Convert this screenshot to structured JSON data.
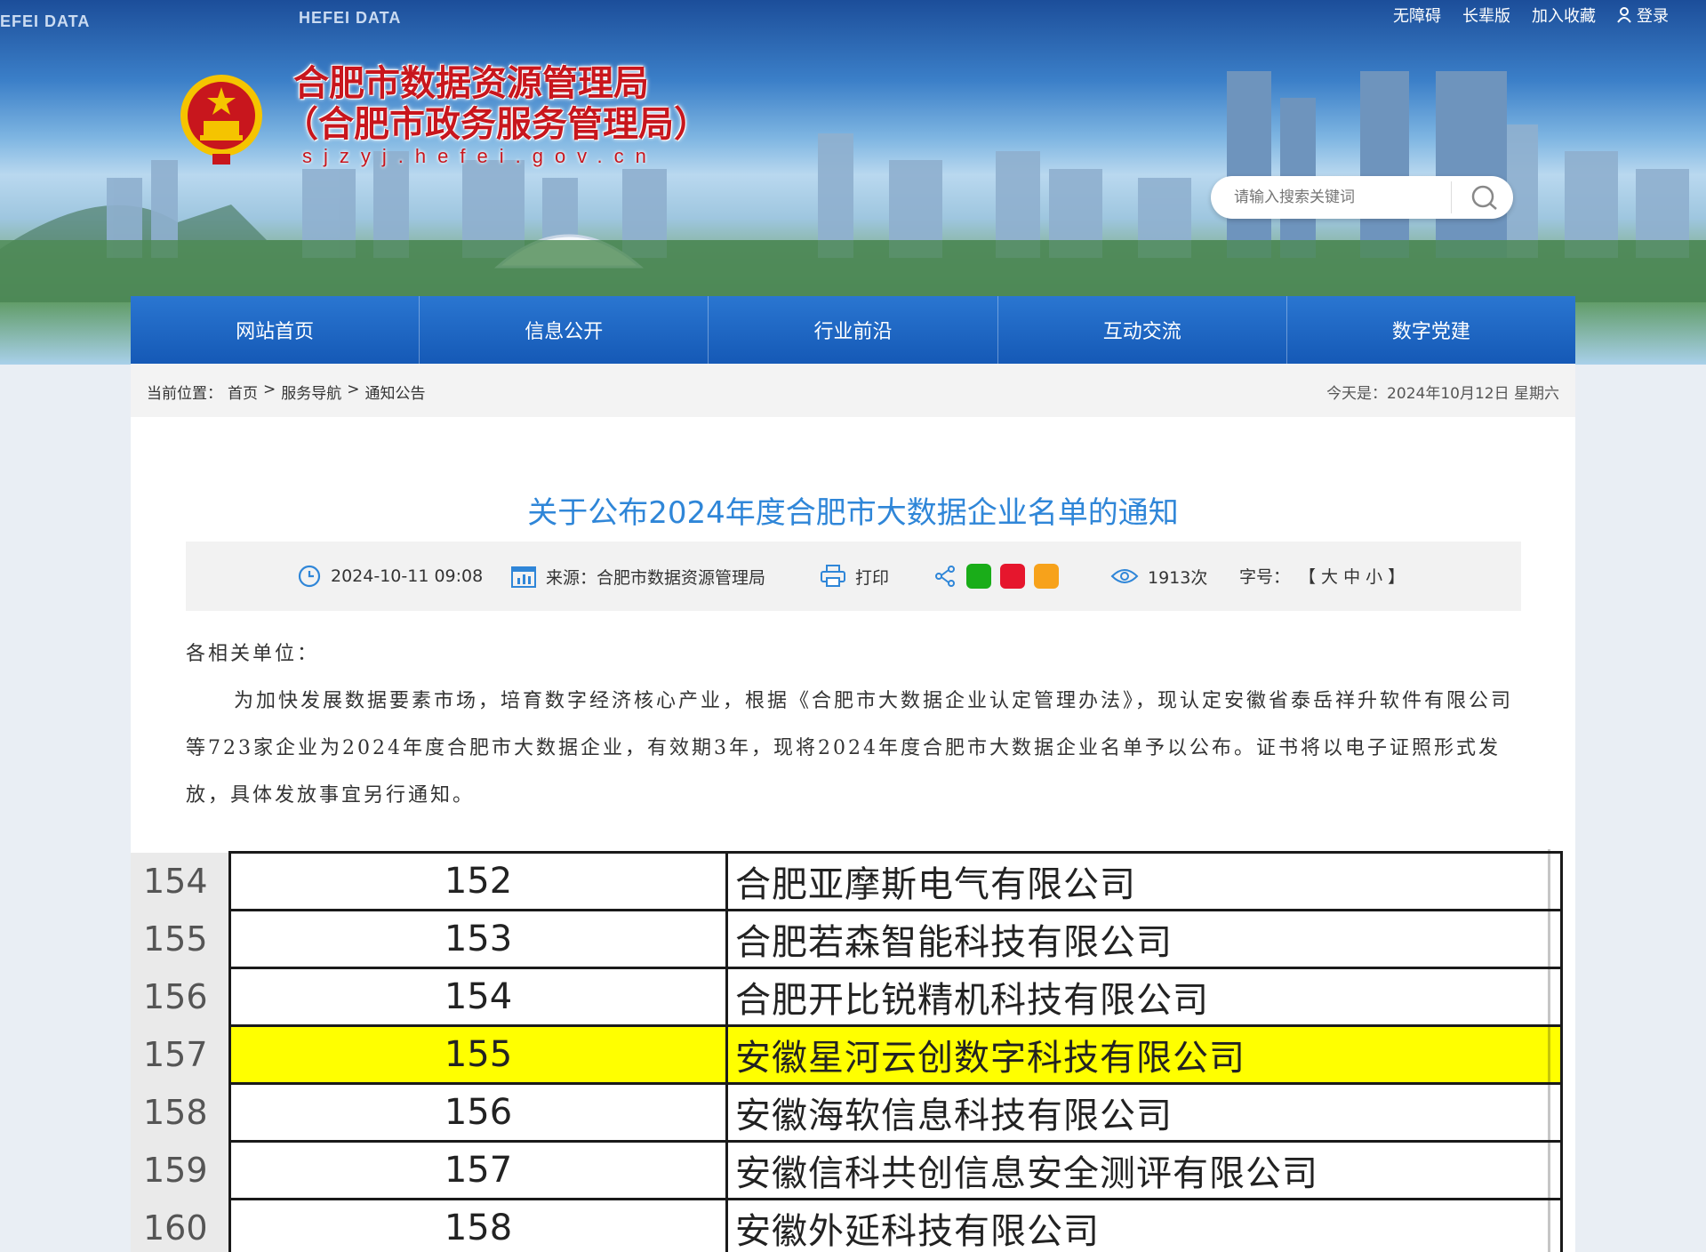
{
  "header": {
    "data_tags": [
      "EFEI DATA",
      "HEFEI DATA"
    ],
    "top_links": [
      "无障碍",
      "长辈版",
      "加入收藏",
      "登录"
    ],
    "site_name": "合肥市数据资源管理局",
    "site_sub": "（合肥市政务服务管理局）",
    "site_domain": "sjzyj.hefei.gov.cn",
    "search_placeholder": "请输入搜索关键词"
  },
  "nav": [
    "网站首页",
    "信息公开",
    "行业前沿",
    "互动交流",
    "数字党建"
  ],
  "breadcrumb": {
    "label": "当前位置：",
    "items": [
      "首页",
      "服务导航",
      "通知公告"
    ],
    "sep": ">",
    "today": "今天是：2024年10月12日 星期六"
  },
  "article": {
    "title": "关于公布2024年度合肥市大数据企业名单的通知",
    "date": "2024-10-11 09:08",
    "source": "来源：合肥市数据资源管理局",
    "print": "打印",
    "views": "1913次",
    "font_size_label": "字号：",
    "font_size_options": "【 大 中 小 】",
    "salutation": "各相关单位：",
    "paragraph": "为加快发展数据要素市场，培育数字经济核心产业，根据《合肥市大数据企业认定管理办法》，现认定安徽省泰岳祥升软件有限公司等723家企业为2024年度合肥市大数据企业，有效期3年，现将2024年度合肥市大数据企业名单予以公布。证书将以电子证照形式发放，具体发放事宜另行通知。"
  },
  "sheet_rows": [
    {
      "row": "154",
      "no": "152",
      "name": "合肥亚摩斯电气有限公司",
      "highlight": false
    },
    {
      "row": "155",
      "no": "153",
      "name": "合肥若森智能科技有限公司",
      "highlight": false
    },
    {
      "row": "156",
      "no": "154",
      "name": "合肥开比锐精机科技有限公司",
      "highlight": false
    },
    {
      "row": "157",
      "no": "155",
      "name": "安徽星河云创数字科技有限公司",
      "highlight": true
    },
    {
      "row": "158",
      "no": "156",
      "name": "安徽海软信息科技有限公司",
      "highlight": false
    },
    {
      "row": "159",
      "no": "157",
      "name": "安徽信科共创信息安全测评有限公司",
      "highlight": false
    },
    {
      "row": "160",
      "no": "158",
      "name": "安徽外延科技有限公司",
      "highlight": false
    }
  ],
  "colors": {
    "nav_blue": "#1f6cc6",
    "title_blue": "#2f86d8",
    "emblem_red": "#c8161d",
    "highlight_yellow": "#ffff00"
  }
}
